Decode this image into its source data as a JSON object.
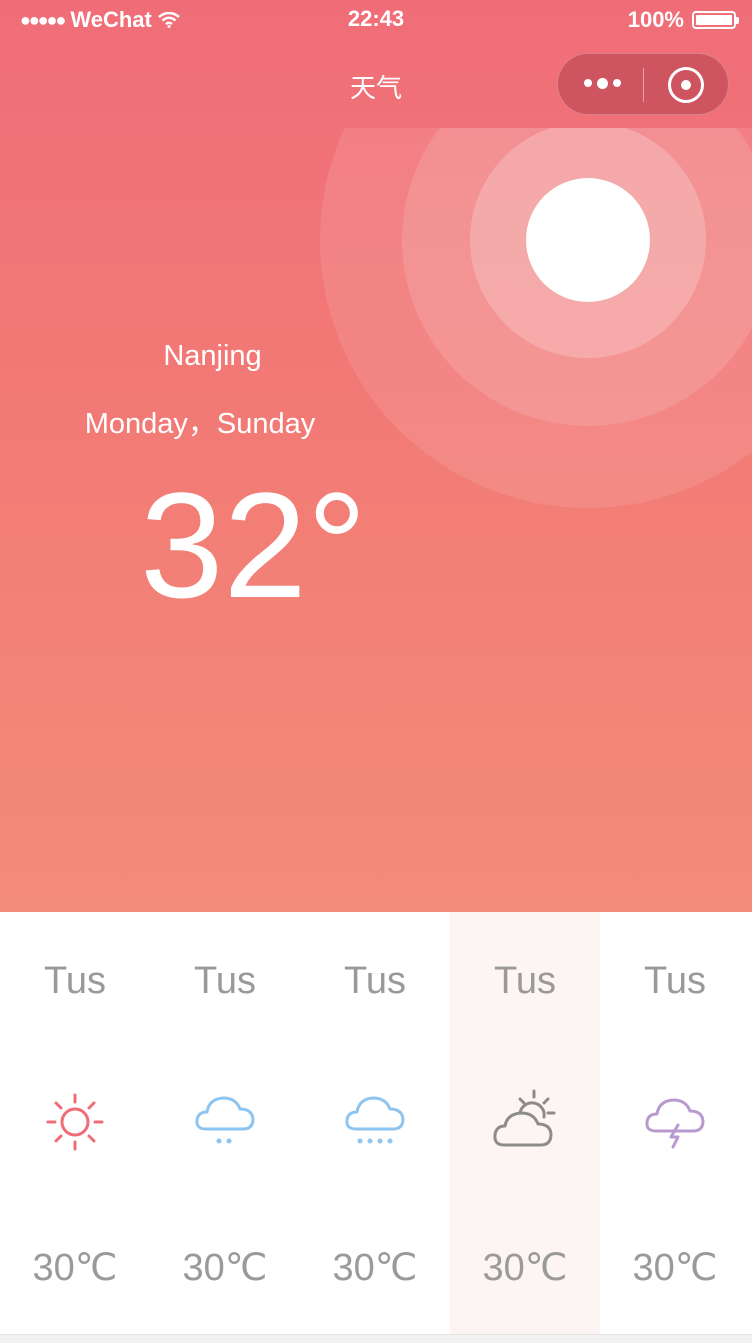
{
  "status_bar": {
    "signal": "●●●●●",
    "carrier": "WeChat",
    "time": "22:43",
    "battery": "100%"
  },
  "nav": {
    "title": "天气"
  },
  "weather": {
    "city": "Nanjing",
    "date": "Monday，Sunday",
    "temperature": "32°"
  },
  "forecast": [
    {
      "day": "Tus",
      "icon": "sunny-icon",
      "temp": "30℃",
      "color": "#f06d78"
    },
    {
      "day": "Tus",
      "icon": "light-rain-icon",
      "temp": "30℃",
      "color": "#8ec5f0"
    },
    {
      "day": "Tus",
      "icon": "heavy-rain-icon",
      "temp": "30℃",
      "color": "#8ec5f0"
    },
    {
      "day": "Tus",
      "icon": "partly-cloudy-icon",
      "temp": "30℃",
      "color": "#8c8c8c"
    },
    {
      "day": "Tus",
      "icon": "thunderstorm-icon",
      "temp": "30℃",
      "color": "#b89ad0"
    }
  ],
  "colors": {
    "gradient_top": "#f06d78",
    "gradient_bottom": "#f38c78",
    "selected_bg": "#fdf5f4"
  }
}
